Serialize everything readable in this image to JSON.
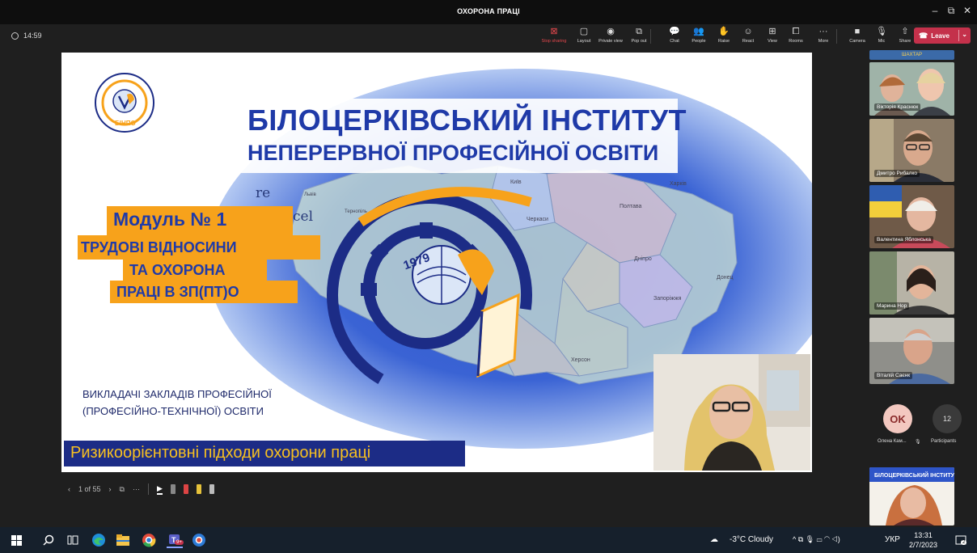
{
  "window": {
    "title": "ОХОРОНА ПРАЦІ",
    "minimize": "–",
    "restore": "⧉",
    "close": "✕"
  },
  "meeting": {
    "timer": "14:59",
    "toolbar": [
      {
        "id": "stop-sharing",
        "label": "Stop sharing",
        "icon": "⊠"
      },
      {
        "id": "layout",
        "label": "Layout",
        "icon": "▢"
      },
      {
        "id": "private-view",
        "label": "Private view",
        "icon": "◉"
      },
      {
        "id": "pop-out",
        "label": "Pop out",
        "icon": "⧉"
      },
      {
        "id": "chat",
        "label": "Chat",
        "icon": "💬"
      },
      {
        "id": "people",
        "label": "People",
        "icon": "👥"
      },
      {
        "id": "raise",
        "label": "Raise",
        "icon": "✋"
      },
      {
        "id": "react",
        "label": "React",
        "icon": "☺"
      },
      {
        "id": "view",
        "label": "View",
        "icon": "⊞"
      },
      {
        "id": "rooms",
        "label": "Rooms",
        "icon": "⧠"
      },
      {
        "id": "more",
        "label": "More",
        "icon": "···"
      },
      {
        "id": "camera",
        "label": "Camera",
        "icon": "■"
      },
      {
        "id": "mic",
        "label": "Mic",
        "icon": "🎙"
      },
      {
        "id": "share",
        "label": "Share",
        "icon": "⇧"
      }
    ],
    "leave_label": "Leave"
  },
  "slide": {
    "title_line1": "БІЛОЦЕРКІВСЬКИЙ ІНСТИТУТ",
    "title_line2": "НЕПЕРЕРВНОЇ ПРОФЕСІЙНОЇ ОСВІТИ",
    "logo_text": "БІНПО",
    "emblem_year": "1979",
    "re": "re",
    "cel": "cel",
    "module_line1": "Модуль № 1",
    "module_line2": "ТРУДОВІ ВІДНОСИНИ",
    "module_line3": "ТА ОХОРОНА",
    "module_line4": "ПРАЦІ В ЗП(ПТ)О",
    "teachers_line1": "ВИКЛАДАЧІ ЗАКЛАДІВ ПРОФЕСІЙНОЇ",
    "teachers_line2": "(ПРОФЕСІЙНО-ТЕХНІЧНОЇ) ОСВІТИ",
    "risk_text": "Ризикоорієнтовні підходи охорони праці",
    "map_labels": [
      "Київ",
      "Харків",
      "Полтава",
      "Черкаси",
      "Дніпро",
      "Запоріжжя",
      "Херсон",
      "Донец",
      "Тернопіль",
      "Львів"
    ]
  },
  "slide_controls": {
    "page": "1 of 55",
    "prev": "‹",
    "next": "›",
    "more": "···"
  },
  "participants": [
    {
      "name": "Вікторія Краснюк"
    },
    {
      "name": "Дмитро Рибалко"
    },
    {
      "name": "Валентина Яблонська"
    },
    {
      "name": "Марина Нор"
    },
    {
      "name": "Віталій Саєнк"
    }
  ],
  "participants_strip": {
    "avatar_initials": "OK",
    "avatar_name": "Олена Кам...",
    "count": "12",
    "count_label": "Participants",
    "top_banner": "ШАХТАР"
  },
  "taskbar": {
    "weather": "-3°C  Cloudy",
    "lang": "УКР",
    "time": "13:31",
    "date": "2/7/2023",
    "teams_badge": "9+",
    "notif_count": "2"
  },
  "colors": {
    "accent_blue": "#1f3aa8",
    "orange": "#f7a21b",
    "leave_red": "#c4314b",
    "risk_bg": "#1c2c86",
    "risk_text": "#f7c020"
  }
}
